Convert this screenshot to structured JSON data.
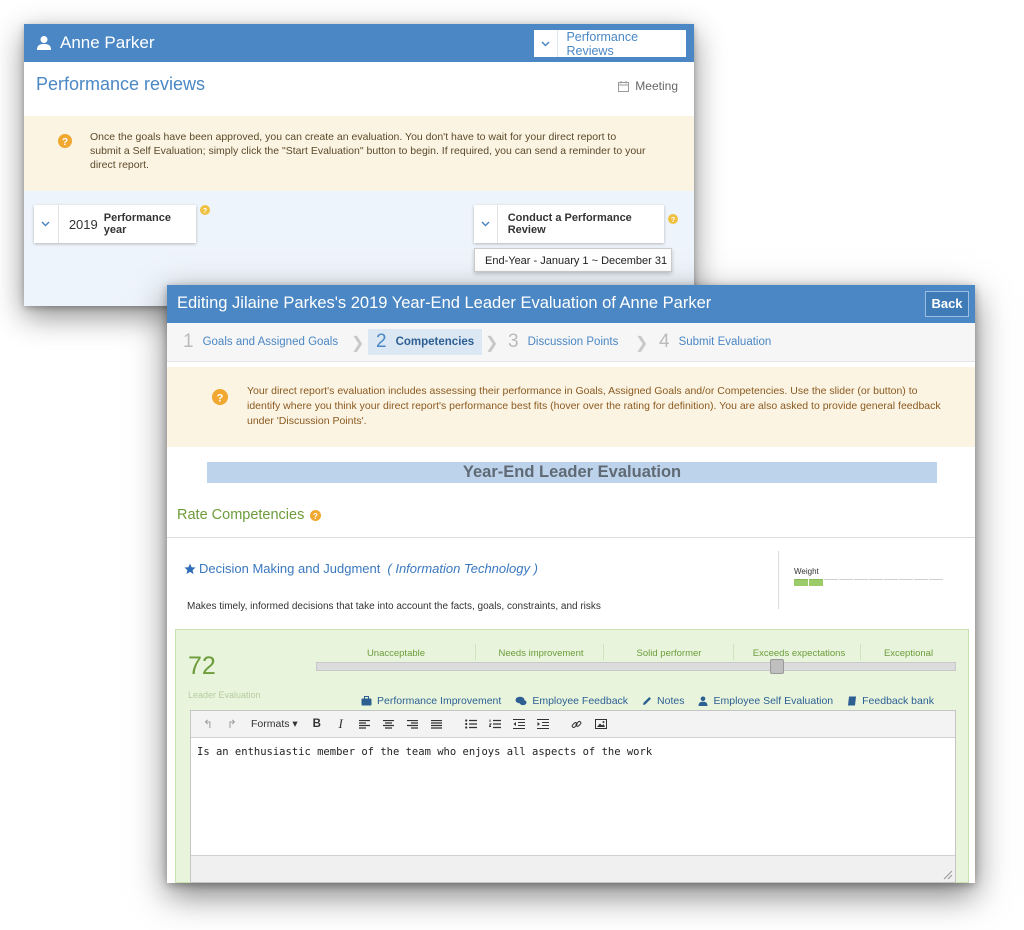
{
  "back_window": {
    "user_name": "Anne Parker",
    "nav_dropdown": "Performance Reviews",
    "title": "Performance reviews",
    "meeting": "Meeting",
    "info": "Once the goals have been approved, you can create an evaluation. You don't have to wait for your direct report to submit a Self Evaluation; simply click the \"Start Evaluation\" button to begin. If required, you can send a reminder to your direct report.",
    "year": "2019",
    "year_label": "Performance year",
    "review_dropdown": "Conduct a Performance Review",
    "review_menu_item": "End-Year - January 1 ~ December 31"
  },
  "front_window": {
    "title": "Editing Jilaine Parkes's 2019 Year-End Leader Evaluation of Anne Parker",
    "back_button": "Back",
    "steps": [
      {
        "num": "1",
        "label": "Goals and Assigned Goals"
      },
      {
        "num": "2",
        "label": "Competencies"
      },
      {
        "num": "3",
        "label": "Discussion Points"
      },
      {
        "num": "4",
        "label": "Submit Evaluation"
      }
    ],
    "active_step": 2,
    "info": "Your direct report's evaluation includes assessing their performance in Goals, Assigned Goals and/or Competencies. Use the slider (or button) to identify where you think your direct report's performance best fits (hover over the rating for definition). You are also asked to provide general feedback under 'Discussion Points'.",
    "banner": "Year-End Leader Evaluation",
    "rate_heading": "Rate Competencies",
    "competency": {
      "name": "Decision Making and Judgment",
      "department": "( Information Technology )",
      "description": "Makes timely, informed decisions that take into account the facts, goals, constraints, and risks",
      "weight_label": "Weight",
      "weight_filled": 2,
      "weight_total": 10
    },
    "evaluation": {
      "score": "72",
      "score_value": 72,
      "score_label": "Leader Evaluation",
      "scale": [
        "Unacceptable",
        "Needs improvement",
        "Solid performer",
        "Exceeds expectations",
        "Exceptional"
      ],
      "links": [
        {
          "icon": "briefcase-icon",
          "label": "Performance Improvement"
        },
        {
          "icon": "comments-icon",
          "label": "Employee Feedback"
        },
        {
          "icon": "pencil-icon",
          "label": "Notes"
        },
        {
          "icon": "user-icon",
          "label": "Employee Self Evaluation"
        },
        {
          "icon": "book-icon",
          "label": "Feedback bank"
        }
      ],
      "toolbar": {
        "formats": "Formats"
      },
      "text": "Is an enthusiastic member of the team who enjoys all aspects of the work"
    }
  },
  "colors": {
    "header_blue": "#4a87c4",
    "info_bg": "#fcf4e3",
    "green": "#6d9c3b",
    "panel_green": "#e8f5dc",
    "help_orange": "#f0a830"
  }
}
